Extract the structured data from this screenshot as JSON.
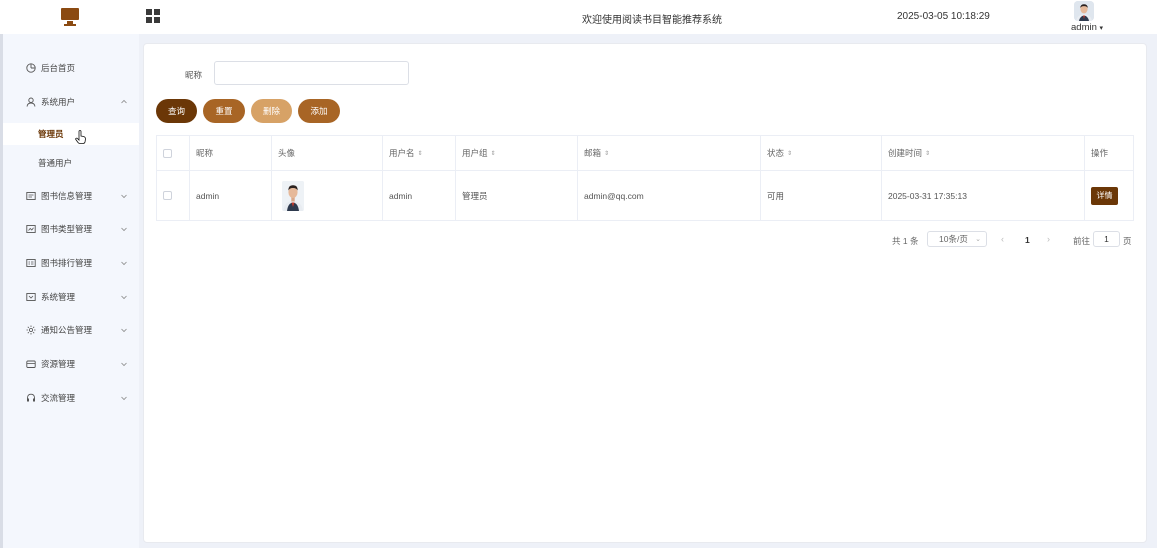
{
  "header": {
    "welcome": "欢迎使用阅读书目智能推荐系统",
    "datetime": "2025-03-05 10:18:29",
    "user": "admin"
  },
  "sidebar": {
    "items": [
      {
        "label": "后台首页",
        "icon": "dashboard-icon"
      },
      {
        "label": "系统用户",
        "icon": "user-icon",
        "expanded": true
      },
      {
        "label": "图书信息管理",
        "icon": "book-icon"
      },
      {
        "label": "图书类型管理",
        "icon": "category-icon"
      },
      {
        "label": "图书排行管理",
        "icon": "ranking-icon"
      },
      {
        "label": "系统管理",
        "icon": "settings-icon"
      },
      {
        "label": "通知公告管理",
        "icon": "notice-icon"
      },
      {
        "label": "资源管理",
        "icon": "resource-icon"
      },
      {
        "label": "交流管理",
        "icon": "headset-icon"
      }
    ],
    "subitems": [
      {
        "label": "管理员",
        "active": true
      },
      {
        "label": "普通用户",
        "active": false
      }
    ]
  },
  "search": {
    "label": "昵称",
    "value": ""
  },
  "buttons": {
    "query": "查询",
    "reset": "重置",
    "delete": "删除",
    "add": "添加"
  },
  "table": {
    "headers": [
      "昵称",
      "头像",
      "用户名",
      "用户组",
      "邮箱",
      "状态",
      "创建时间",
      "操作"
    ],
    "rows": [
      {
        "nickname": "admin",
        "username": "admin",
        "group": "管理员",
        "email": "admin@qq.com",
        "status": "可用",
        "created": "2025-03-31 17:35:13",
        "action": "详情"
      }
    ]
  },
  "pagination": {
    "total": "共 1 条",
    "page_size": "10条/页",
    "current": "1",
    "goto_label": "前往",
    "goto_value": "1",
    "unit": "页"
  },
  "colors": {
    "primary": "#6b3707",
    "secondary": "#a86525",
    "light": "#d7a266"
  }
}
